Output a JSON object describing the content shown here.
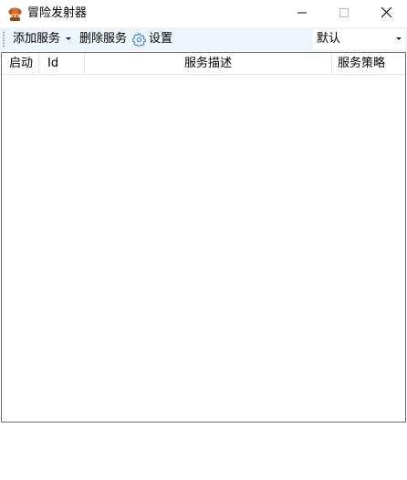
{
  "window": {
    "title": "冒险发射器",
    "icon": "app-character-icon",
    "controls": [
      "minimize-icon",
      "maximize-icon",
      "close-icon"
    ]
  },
  "toolbar": {
    "add_service_label": "添加服务",
    "delete_service_label": "删除服务",
    "settings_label": "设置",
    "settings_icon": "gear-icon",
    "profile_select_value": "默认"
  },
  "table": {
    "columns": [
      "启动",
      "Id",
      "服务描述",
      "服务策略"
    ],
    "rows": []
  },
  "colors": {
    "toolbar_bg": "#eef4fb",
    "settings_icon": "#2f7fd6",
    "border": "#6d6d6d"
  }
}
